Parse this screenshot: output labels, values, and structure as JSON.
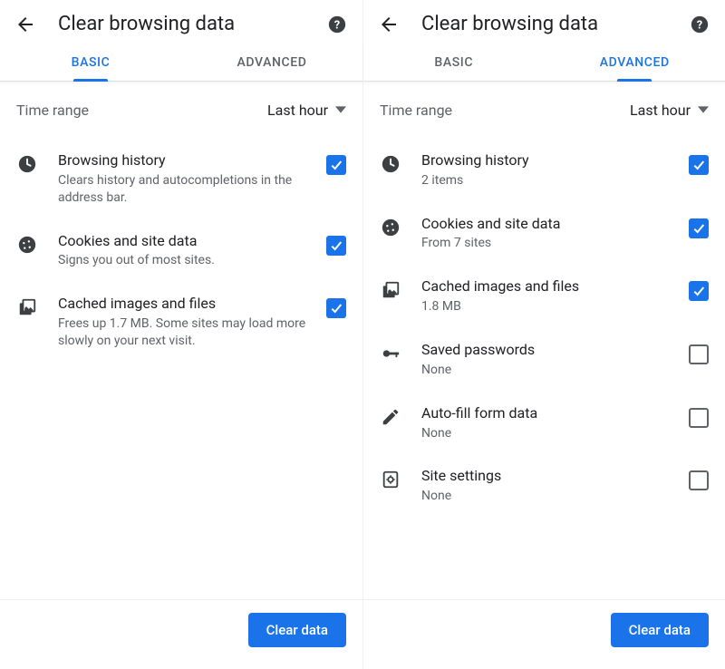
{
  "left": {
    "header": {
      "title": "Clear browsing data"
    },
    "tabs": {
      "basic": "BASIC",
      "advanced": "ADVANCED",
      "active": "basic"
    },
    "time": {
      "label": "Time range",
      "value": "Last hour"
    },
    "items": [
      {
        "icon": "clock",
        "title": "Browsing history",
        "sub": "Clears history and autocompletions in the address bar.",
        "checked": true
      },
      {
        "icon": "cookie",
        "title": "Cookies and site data",
        "sub": "Signs you out of most sites.",
        "checked": true
      },
      {
        "icon": "image-stack",
        "title": "Cached images and files",
        "sub": "Frees up 1.7 MB. Some sites may load more slowly on your next visit.",
        "checked": true
      }
    ],
    "clear_label": "Clear data"
  },
  "right": {
    "header": {
      "title": "Clear browsing data"
    },
    "tabs": {
      "basic": "BASIC",
      "advanced": "ADVANCED",
      "active": "advanced"
    },
    "time": {
      "label": "Time range",
      "value": "Last hour"
    },
    "items": [
      {
        "icon": "clock",
        "title": "Browsing history",
        "sub": "2 items",
        "checked": true
      },
      {
        "icon": "cookie",
        "title": "Cookies and site data",
        "sub": "From 7 sites",
        "checked": true
      },
      {
        "icon": "image-stack",
        "title": "Cached images and files",
        "sub": "1.8 MB",
        "checked": true
      },
      {
        "icon": "key",
        "title": "Saved passwords",
        "sub": "None",
        "checked": false
      },
      {
        "icon": "pencil",
        "title": "Auto-fill form data",
        "sub": "None",
        "checked": false
      },
      {
        "icon": "settings-page",
        "title": "Site settings",
        "sub": "None",
        "checked": false
      }
    ],
    "clear_label": "Clear data"
  }
}
